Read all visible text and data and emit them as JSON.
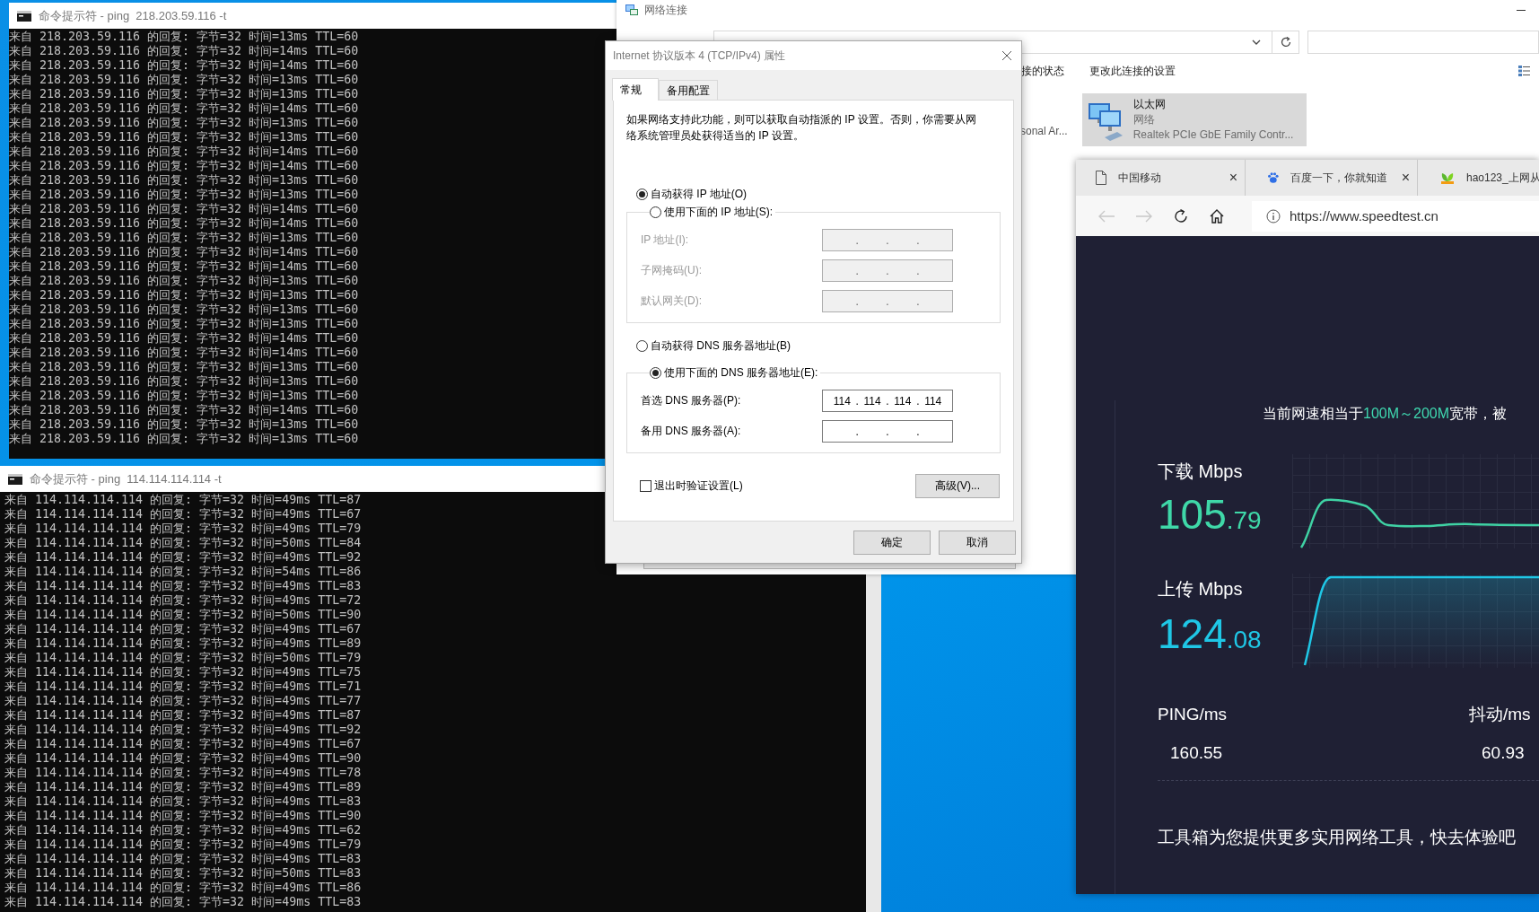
{
  "consoles": [
    {
      "title": "命令提示符 - ping  218.203.59.116 -t",
      "lines": [
        "来自 218.203.59.116 的回复: 字节=32 时间=13ms TTL=60",
        "来自 218.203.59.116 的回复: 字节=32 时间=14ms TTL=60",
        "来自 218.203.59.116 的回复: 字节=32 时间=14ms TTL=60",
        "来自 218.203.59.116 的回复: 字节=32 时间=13ms TTL=60",
        "来自 218.203.59.116 的回复: 字节=32 时间=13ms TTL=60",
        "来自 218.203.59.116 的回复: 字节=32 时间=14ms TTL=60",
        "来自 218.203.59.116 的回复: 字节=32 时间=13ms TTL=60",
        "来自 218.203.59.116 的回复: 字节=32 时间=13ms TTL=60",
        "来自 218.203.59.116 的回复: 字节=32 时间=14ms TTL=60",
        "来自 218.203.59.116 的回复: 字节=32 时间=14ms TTL=60",
        "来自 218.203.59.116 的回复: 字节=32 时间=13ms TTL=60",
        "来自 218.203.59.116 的回复: 字节=32 时间=13ms TTL=60",
        "来自 218.203.59.116 的回复: 字节=32 时间=14ms TTL=60",
        "来自 218.203.59.116 的回复: 字节=32 时间=14ms TTL=60",
        "来自 218.203.59.116 的回复: 字节=32 时间=13ms TTL=60",
        "来自 218.203.59.116 的回复: 字节=32 时间=14ms TTL=60",
        "来自 218.203.59.116 的回复: 字节=32 时间=14ms TTL=60",
        "来自 218.203.59.116 的回复: 字节=32 时间=13ms TTL=60",
        "来自 218.203.59.116 的回复: 字节=32 时间=13ms TTL=60",
        "来自 218.203.59.116 的回复: 字节=32 时间=13ms TTL=60",
        "来自 218.203.59.116 的回复: 字节=32 时间=13ms TTL=60",
        "来自 218.203.59.116 的回复: 字节=32 时间=14ms TTL=60",
        "来自 218.203.59.116 的回复: 字节=32 时间=14ms TTL=60",
        "来自 218.203.59.116 的回复: 字节=32 时间=13ms TTL=60",
        "来自 218.203.59.116 的回复: 字节=32 时间=13ms TTL=60",
        "来自 218.203.59.116 的回复: 字节=32 时间=13ms TTL=60",
        "来自 218.203.59.116 的回复: 字节=32 时间=14ms TTL=60",
        "来自 218.203.59.116 的回复: 字节=32 时间=13ms TTL=60",
        "来自 218.203.59.116 的回复: 字节=32 时间=13ms TTL=60"
      ]
    },
    {
      "title": "命令提示符 - ping  114.114.114.114 -t",
      "lines": [
        "来自 114.114.114.114 的回复: 字节=32 时间=49ms TTL=87",
        "来自 114.114.114.114 的回复: 字节=32 时间=49ms TTL=67",
        "来自 114.114.114.114 的回复: 字节=32 时间=49ms TTL=79",
        "来自 114.114.114.114 的回复: 字节=32 时间=50ms TTL=84",
        "来自 114.114.114.114 的回复: 字节=32 时间=49ms TTL=92",
        "来自 114.114.114.114 的回复: 字节=32 时间=54ms TTL=86",
        "来自 114.114.114.114 的回复: 字节=32 时间=49ms TTL=83",
        "来自 114.114.114.114 的回复: 字节=32 时间=49ms TTL=72",
        "来自 114.114.114.114 的回复: 字节=32 时间=50ms TTL=90",
        "来自 114.114.114.114 的回复: 字节=32 时间=49ms TTL=67",
        "来自 114.114.114.114 的回复: 字节=32 时间=49ms TTL=89",
        "来自 114.114.114.114 的回复: 字节=32 时间=50ms TTL=79",
        "来自 114.114.114.114 的回复: 字节=32 时间=49ms TTL=75",
        "来自 114.114.114.114 的回复: 字节=32 时间=49ms TTL=71",
        "来自 114.114.114.114 的回复: 字节=32 时间=49ms TTL=77",
        "来自 114.114.114.114 的回复: 字节=32 时间=49ms TTL=87",
        "来自 114.114.114.114 的回复: 字节=32 时间=49ms TTL=92",
        "来自 114.114.114.114 的回复: 字节=32 时间=49ms TTL=67",
        "来自 114.114.114.114 的回复: 字节=32 时间=49ms TTL=90",
        "来自 114.114.114.114 的回复: 字节=32 时间=49ms TTL=78",
        "来自 114.114.114.114 的回复: 字节=32 时间=49ms TTL=89",
        "来自 114.114.114.114 的回复: 字节=32 时间=49ms TTL=83",
        "来自 114.114.114.114 的回复: 字节=32 时间=49ms TTL=90",
        "来自 114.114.114.114 的回复: 字节=32 时间=49ms TTL=62",
        "来自 114.114.114.114 的回复: 字节=32 时间=49ms TTL=79",
        "来自 114.114.114.114 的回复: 字节=32 时间=49ms TTL=83",
        "来自 114.114.114.114 的回复: 字节=32 时间=50ms TTL=83",
        "来自 114.114.114.114 的回复: 字节=32 时间=49ms TTL=86",
        "来自 114.114.114.114 的回复: 字节=32 时间=49ms TTL=83"
      ]
    }
  ],
  "explorer": {
    "title": "网络连接",
    "commands": [
      "接的状态",
      "更改此连接的设置"
    ],
    "items": [
      {
        "kind": "partial",
        "name": "sonal Ar..."
      },
      {
        "kind": "adapter",
        "selected": true,
        "name": "以太网",
        "status": "网络",
        "device": "Realtek PCIe GbE Family Contr..."
      }
    ]
  },
  "dialog": {
    "title": "Internet 协议版本 4 (TCP/IPv4) 属性",
    "tabs": [
      {
        "label": "常规",
        "selected": true
      },
      {
        "label": "备用配置",
        "selected": false
      }
    ],
    "description": "如果网络支持此功能，则可以获取自动指派的 IP 设置。否则，你需要从网络系统管理员处获得适当的 IP 设置。",
    "ip_mode": [
      {
        "label": "自动获得 IP 地址(O)",
        "selected": true
      },
      {
        "label": "使用下面的 IP 地址(S):",
        "selected": false
      }
    ],
    "ip_fields": [
      {
        "label": "IP 地址(I):",
        "disabled": true,
        "parts": [
          ".",
          ".",
          "."
        ]
      },
      {
        "label": "子网掩码(U):",
        "disabled": true,
        "parts": [
          ".",
          ".",
          "."
        ]
      },
      {
        "label": "默认网关(D):",
        "disabled": true,
        "parts": [
          ".",
          ".",
          "."
        ]
      }
    ],
    "dns_mode": [
      {
        "label": "自动获得 DNS 服务器地址(B)",
        "selected": false
      },
      {
        "label": "使用下面的 DNS 服务器地址(E):",
        "selected": true
      }
    ],
    "dns_fields": [
      {
        "label": "首选 DNS 服务器(P):",
        "disabled": false,
        "parts": [
          "114",
          ".",
          "114",
          ".",
          "114",
          ".",
          "114"
        ]
      },
      {
        "label": "备用 DNS 服务器(A):",
        "disabled": false,
        "parts": [
          ".",
          ".",
          "."
        ]
      }
    ],
    "validate": {
      "label": "退出时验证设置(L)",
      "checked": false
    },
    "advanced_button": "高级(V)...",
    "buttons": [
      "确定",
      "取消"
    ]
  },
  "browser": {
    "tabs": [
      {
        "title": "中国移动",
        "kind": "page",
        "close": "×"
      },
      {
        "title": "百度一下，你就知道",
        "kind": "paw",
        "close": "×"
      },
      {
        "title": "hao123_上网从",
        "kind": "leaf"
      }
    ],
    "url": "https://www.speedtest.cn",
    "speedtest": {
      "summary": [
        {
          "text": "当前网速相当于",
          "highlight": false
        },
        {
          "text": "100M～200M",
          "highlight": true
        },
        {
          "text": "宽带，被",
          "highlight": false
        }
      ],
      "metrics": [
        {
          "kind": "download",
          "label": "下载 Mbps",
          "integer": "105",
          "decimal": ".79"
        },
        {
          "kind": "upload",
          "label": "上传 Mbps",
          "integer": "124",
          "decimal": ".08"
        }
      ],
      "stats": [
        {
          "label": "PING/ms",
          "value": "160.55"
        },
        {
          "label": "抖动/ms",
          "value": "60.93"
        }
      ],
      "promo": "工具箱为您提供更多实用网络工具，快去体验吧"
    }
  }
}
